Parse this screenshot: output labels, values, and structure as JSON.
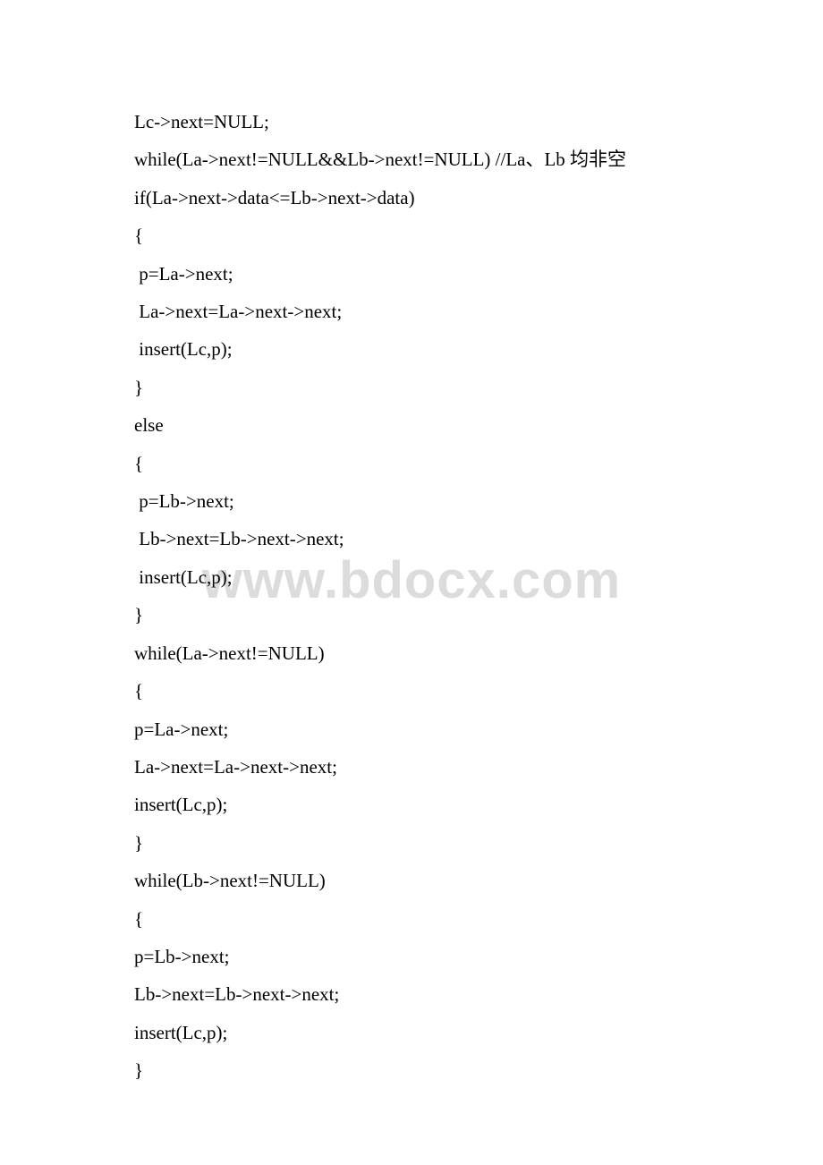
{
  "watermark": "www.bdocx.com",
  "lines": [
    "Lc->next=NULL;",
    "while(La->next!=NULL&&Lb->next!=NULL) //La、Lb 均非空",
    "if(La->next->data<=Lb->next->data)",
    "{",
    " p=La->next;",
    " La->next=La->next->next;",
    " insert(Lc,p);",
    "}",
    "else",
    "{",
    " p=Lb->next;",
    " Lb->next=Lb->next->next;",
    " insert(Lc,p);",
    "}",
    "while(La->next!=NULL)",
    "{",
    "p=La->next;",
    "La->next=La->next->next;",
    "insert(Lc,p);",
    "}",
    "while(Lb->next!=NULL)",
    "{",
    "p=Lb->next;",
    "Lb->next=Lb->next->next;",
    "insert(Lc,p);",
    "}"
  ]
}
